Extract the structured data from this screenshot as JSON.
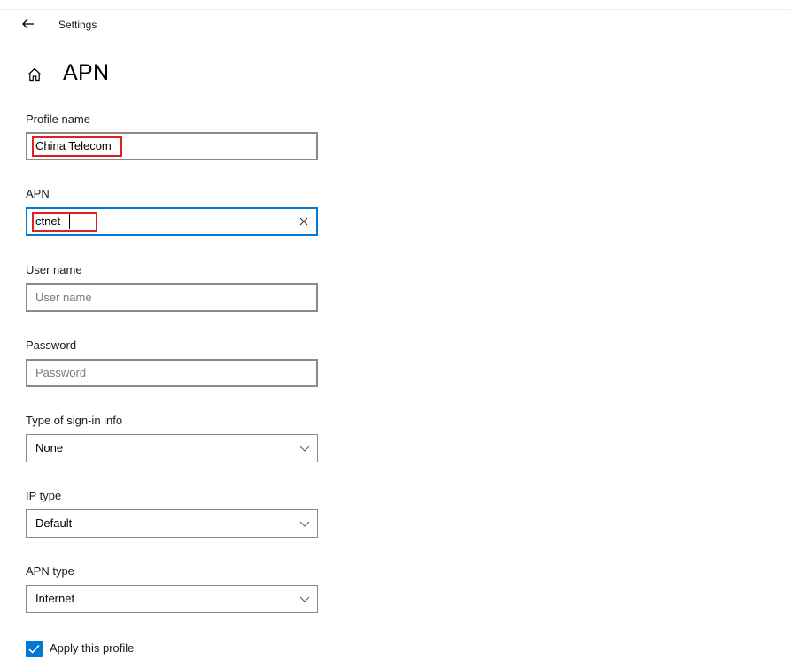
{
  "header": {
    "back_icon": "back-arrow-icon",
    "app_title": "Settings"
  },
  "page": {
    "home_icon": "home-icon",
    "title": "APN"
  },
  "form": {
    "profile_name": {
      "label": "Profile name",
      "value": "China Telecom"
    },
    "apn": {
      "label": "APN",
      "value": "ctnet",
      "clear_icon": "clear-x-icon"
    },
    "user_name": {
      "label": "User name",
      "value": "",
      "placeholder": "User name"
    },
    "password": {
      "label": "Password",
      "value": "",
      "placeholder": "Password"
    },
    "sign_in_type": {
      "label": "Type of sign-in info",
      "selected": "None"
    },
    "ip_type": {
      "label": "IP type",
      "selected": "Default"
    },
    "apn_type": {
      "label": "APN type",
      "selected": "Internet"
    },
    "apply_profile": {
      "label": "Apply this profile",
      "checked": true
    }
  },
  "colors": {
    "accent": "#0078d4",
    "annotation_red": "#e02020",
    "border": "#8a8a8a"
  }
}
